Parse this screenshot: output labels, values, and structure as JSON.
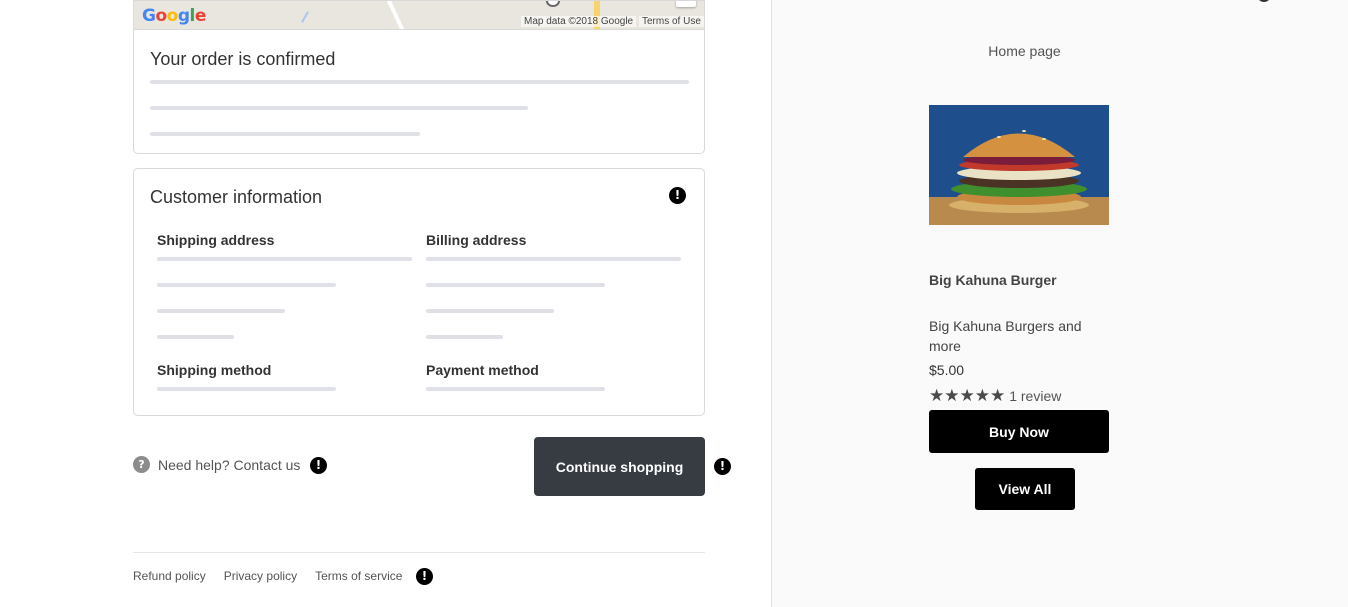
{
  "map": {
    "logo_text": "Google",
    "attribution": "Map data ©2018 Google",
    "terms_link": "Terms of Use"
  },
  "order": {
    "title": "Your order is confirmed"
  },
  "customer": {
    "title": "Customer information",
    "shipping_address_label": "Shipping address",
    "billing_address_label": "Billing address",
    "shipping_method_label": "Shipping method",
    "payment_method_label": "Payment method"
  },
  "help": {
    "icon_glyph": "?",
    "text": "Need help? Contact us"
  },
  "actions": {
    "continue_label": "Continue shopping"
  },
  "footer": {
    "links": [
      "Refund policy",
      "Privacy policy",
      "Terms of service"
    ]
  },
  "alert_glyph": "!",
  "sidebar": {
    "home_link": "Home page",
    "product": {
      "name": "Big Kahuna Burger",
      "description": "Big Kahuna Burgers and more",
      "price": "$5.00",
      "stars": "★★★★★",
      "rating_value": 5,
      "review_text": "1 review",
      "buy_label": "Buy Now",
      "image_alt": "burger-image"
    },
    "view_all_label": "View All"
  },
  "colors": {
    "continue_button": "#373c43",
    "cta_button": "#000000",
    "skeleton": "#dfe1e6",
    "sidebar_bg": "#fafafa"
  }
}
